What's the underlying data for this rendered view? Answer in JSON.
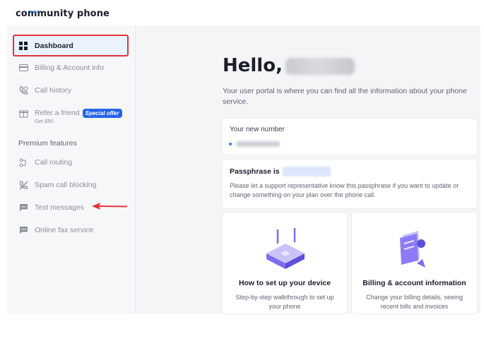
{
  "header": {
    "logo_text": "community phone"
  },
  "sidebar": {
    "items": [
      {
        "label": "Dashboard",
        "icon": "grid-icon"
      },
      {
        "label": "Billing & Account info",
        "icon": "credit-card-icon"
      },
      {
        "label": "Call history",
        "icon": "phone-history-icon"
      },
      {
        "label": "Refer a friend",
        "icon": "gift-icon",
        "badge": "Special offer",
        "sublabel": "Get $50"
      }
    ],
    "premium_label": "Premium features",
    "premium_items": [
      {
        "label": "Call routing",
        "icon": "routing-icon"
      },
      {
        "label": "Spam call blocking",
        "icon": "phone-blocked-icon"
      },
      {
        "label": "Text messages",
        "icon": "message-icon"
      },
      {
        "label": "Online fax service",
        "icon": "fax-icon"
      }
    ]
  },
  "main": {
    "greeting": "Hello,",
    "intro": "Your user portal is where you can find all the information about your phone service.",
    "number_card": {
      "label": "Your new number"
    },
    "passphrase_card": {
      "label": "Passphrase is",
      "description": "Please let a support representative know this passphrase if you want to update or change something on your plan over the phone call."
    },
    "setup_card": {
      "title": "How to set up your device",
      "description": "Step-by-step walkthrough to set up your phone"
    },
    "billing_card": {
      "title": "Billing & account information",
      "description": "Change your billing details, seeing recent bills and invoices"
    }
  },
  "colors": {
    "accent": "#2563eb",
    "highlight_border": "#e0343c",
    "arrow": "#e0343c",
    "illustration": "#7c6cf0"
  }
}
